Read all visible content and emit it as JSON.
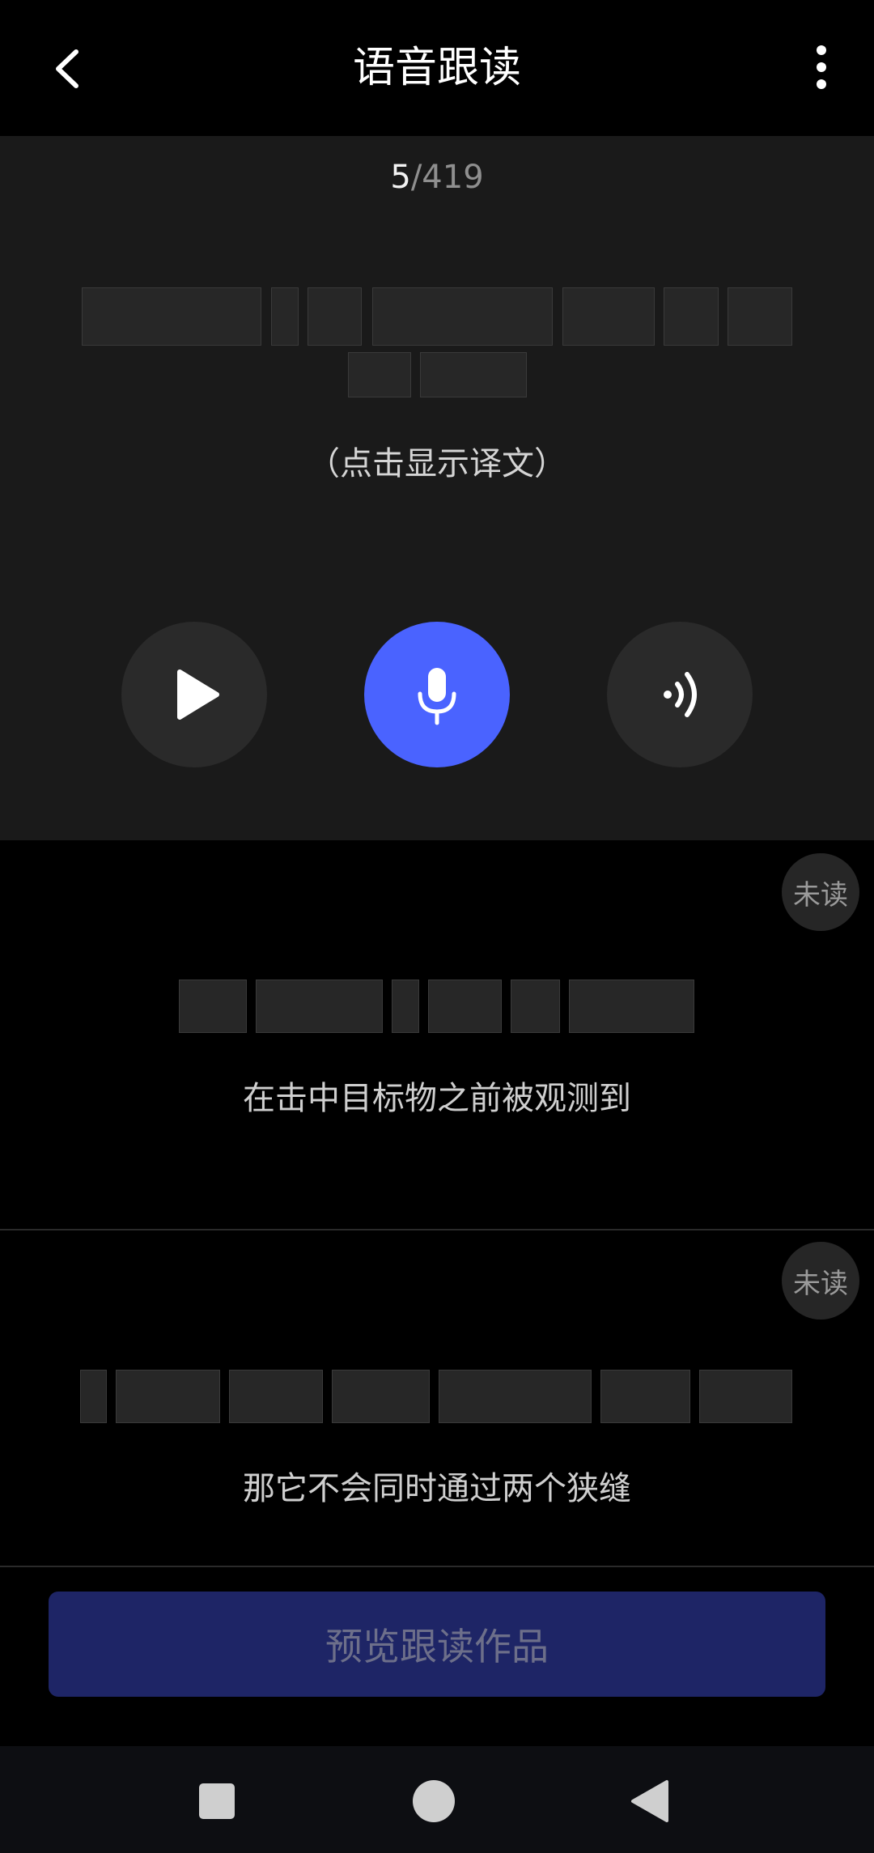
{
  "header": {
    "title": "语音跟读",
    "back_icon": "chevron-left-icon",
    "more_icon": "more-vertical-icon"
  },
  "progress": {
    "current": "5",
    "total": "/419"
  },
  "active": {
    "hint": "（点击显示译文）",
    "controls": {
      "play_icon": "play-icon",
      "record_icon": "microphone-icon",
      "listen_icon": "playback-wave-icon"
    }
  },
  "items": [
    {
      "badge": "未读",
      "translation": "在击中目标物之前被观测到"
    },
    {
      "badge": "未读",
      "translation": "那它不会同时通过两个狭缝"
    }
  ],
  "footer": {
    "preview_label": "预览跟读作品"
  },
  "colors": {
    "accent": "#4a63ff",
    "button_disabled": "#1e2566",
    "card_bg": "#1a1a1a"
  }
}
